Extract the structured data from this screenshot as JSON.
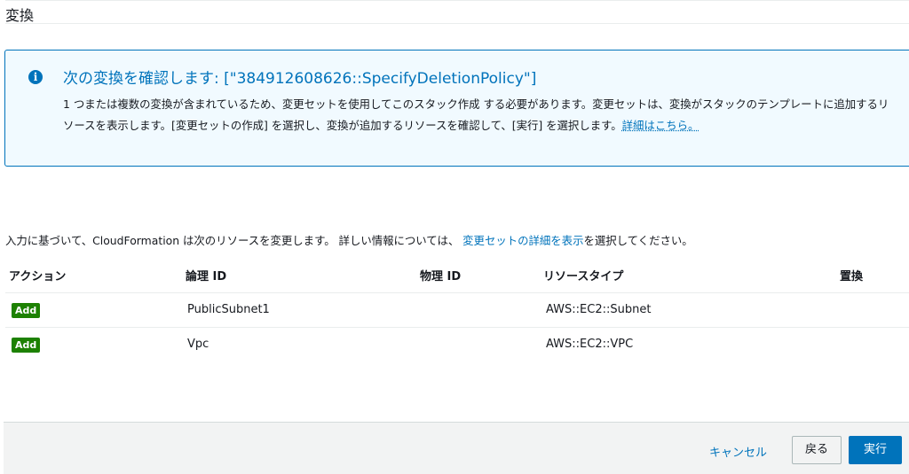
{
  "section": {
    "title": "変換"
  },
  "info": {
    "icon": "info-icon",
    "title": "次の変換を確認します: [\"384912608626::SpecifyDeletionPolicy\"]",
    "body": "1 つまたは複数の変換が含まれているため、変更セットを使用してこのスタック作成 する必要があります。変更セットは、変換がスタックのテンプレートに追加するリソースを表示します。[変更セットの作成] を選択し、変換が追加するリソースを確認して、[実行] を選択します。",
    "link": "詳細はこちら。"
  },
  "description": {
    "prefix": "入力に基づいて、CloudFormation は次のリソースを変更します。 詳しい情報については、 ",
    "link": "変更セットの詳細を表示",
    "suffix": "を選択してください。"
  },
  "table": {
    "headers": {
      "action": "アクション",
      "logical_id": "論理 ID",
      "physical_id": "物理 ID",
      "resource_type": "リソースタイプ",
      "replacement": "置換"
    },
    "rows": [
      {
        "action": "Add",
        "logical_id": "PublicSubnet1",
        "physical_id": "",
        "resource_type": "AWS::EC2::Subnet",
        "replacement": ""
      },
      {
        "action": "Add",
        "logical_id": "Vpc",
        "physical_id": "",
        "resource_type": "AWS::EC2::VPC",
        "replacement": ""
      }
    ]
  },
  "footer": {
    "cancel": "キャンセル",
    "back": "戻る",
    "execute": "実行"
  },
  "colors": {
    "accent": "#0073bb",
    "add_badge": "#1d8102",
    "info_bg": "#f1faff"
  }
}
